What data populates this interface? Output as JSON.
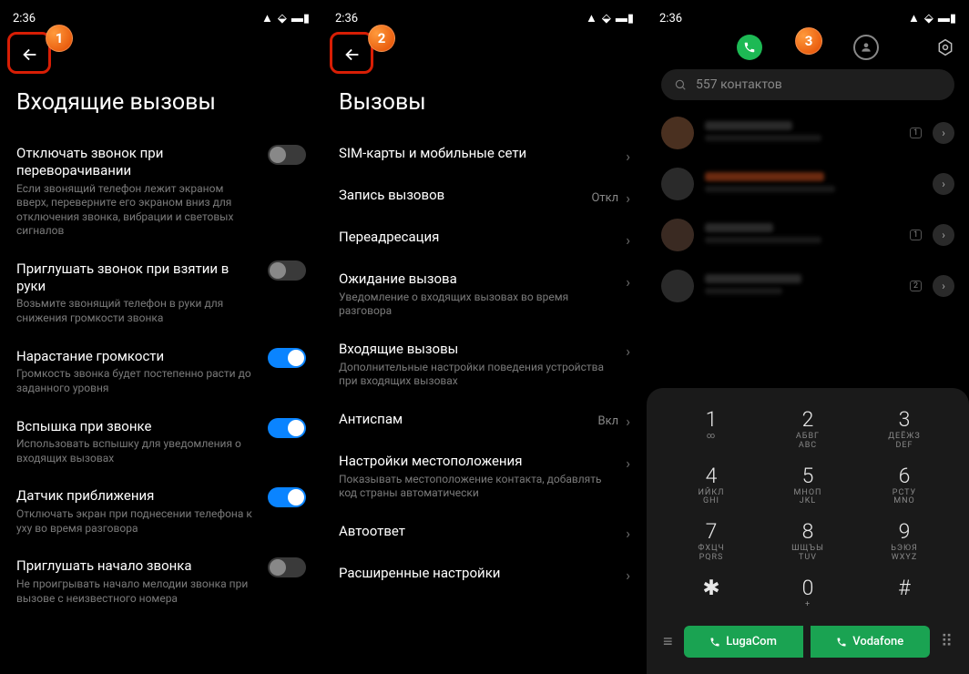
{
  "status_time": "2:36",
  "badges": [
    "1",
    "2",
    "3"
  ],
  "screen1": {
    "title": "Входящие вызовы",
    "items": [
      {
        "title": "Отключать звонок при переворачивании",
        "desc": "Если звонящий телефон лежит экраном вверх, переверните его экраном вниз для отключения звонка, вибрации и световых сигналов",
        "toggle": "off"
      },
      {
        "title": "Приглушать звонок при взятии в руки",
        "desc": "Возьмите звонящий телефон в руки для снижения громкости звонка",
        "toggle": "off"
      },
      {
        "title": "Нарастание громкости",
        "desc": "Громкость звонка будет постепенно расти до заданного уровня",
        "toggle": "on"
      },
      {
        "title": "Вспышка при звонке",
        "desc": "Использовать вспышку для уведомления о входящих вызовах",
        "toggle": "on"
      },
      {
        "title": "Датчик приближения",
        "desc": "Отключать экран при поднесении телефона к уху во время разговора",
        "toggle": "on"
      },
      {
        "title": "Приглушать начало звонка",
        "desc": "Не проигрывать начало мелодии звонка при вызове с неизвестного номера",
        "toggle": "off"
      }
    ]
  },
  "screen2": {
    "title": "Вызовы",
    "items": [
      {
        "title": "SIM-карты и мобильные сети",
        "desc": "",
        "value": "",
        "chev": true
      },
      {
        "title": "Запись вызовов",
        "desc": "",
        "value": "Откл",
        "chev": true
      },
      {
        "title": "Переадресация",
        "desc": "",
        "value": "",
        "chev": true
      },
      {
        "title": "Ожидание вызова",
        "desc": "Уведомление о входящих вызовах во время разговора",
        "value": "",
        "chev": true
      },
      {
        "title": "Входящие вызовы",
        "desc": "Дополнительные настройки поведения устройства при входящих вызовах",
        "value": "",
        "chev": true
      },
      {
        "title": "Антиспам",
        "desc": "",
        "value": "Вкл",
        "chev": true
      },
      {
        "title": "Настройки местоположения",
        "desc": "Показывать местоположение контакта, добавлять код страны автоматически",
        "value": "",
        "chev": true
      },
      {
        "title": "Автоответ",
        "desc": "",
        "value": "",
        "chev": true
      },
      {
        "title": "Расширенные настройки",
        "desc": "",
        "value": "",
        "chev": true
      }
    ]
  },
  "screen3": {
    "search_placeholder": "557 контактов",
    "dialpad": [
      [
        {
          "n": "1",
          "l": "∞"
        },
        {
          "n": "2",
          "l": "АБВГ",
          "l2": "ABC"
        },
        {
          "n": "3",
          "l": "ДЕЁЖЗ",
          "l2": "DEF"
        }
      ],
      [
        {
          "n": "4",
          "l": "ИЙКЛ",
          "l2": "GHI"
        },
        {
          "n": "5",
          "l": "МНОП",
          "l2": "JKL"
        },
        {
          "n": "6",
          "l": "РСТУ",
          "l2": "MNO"
        }
      ],
      [
        {
          "n": "7",
          "l": "ФХЦЧ",
          "l2": "PQRS"
        },
        {
          "n": "8",
          "l": "ШЩЪЫ",
          "l2": "TUV"
        },
        {
          "n": "9",
          "l": "ЬЭЮЯ",
          "l2": "WXYZ"
        }
      ],
      [
        {
          "n": "✱",
          "l": ""
        },
        {
          "n": "0",
          "l": "+"
        },
        {
          "n": "#",
          "l": ""
        }
      ]
    ],
    "sim1": "LugaCom",
    "sim2": "Vodafone"
  }
}
